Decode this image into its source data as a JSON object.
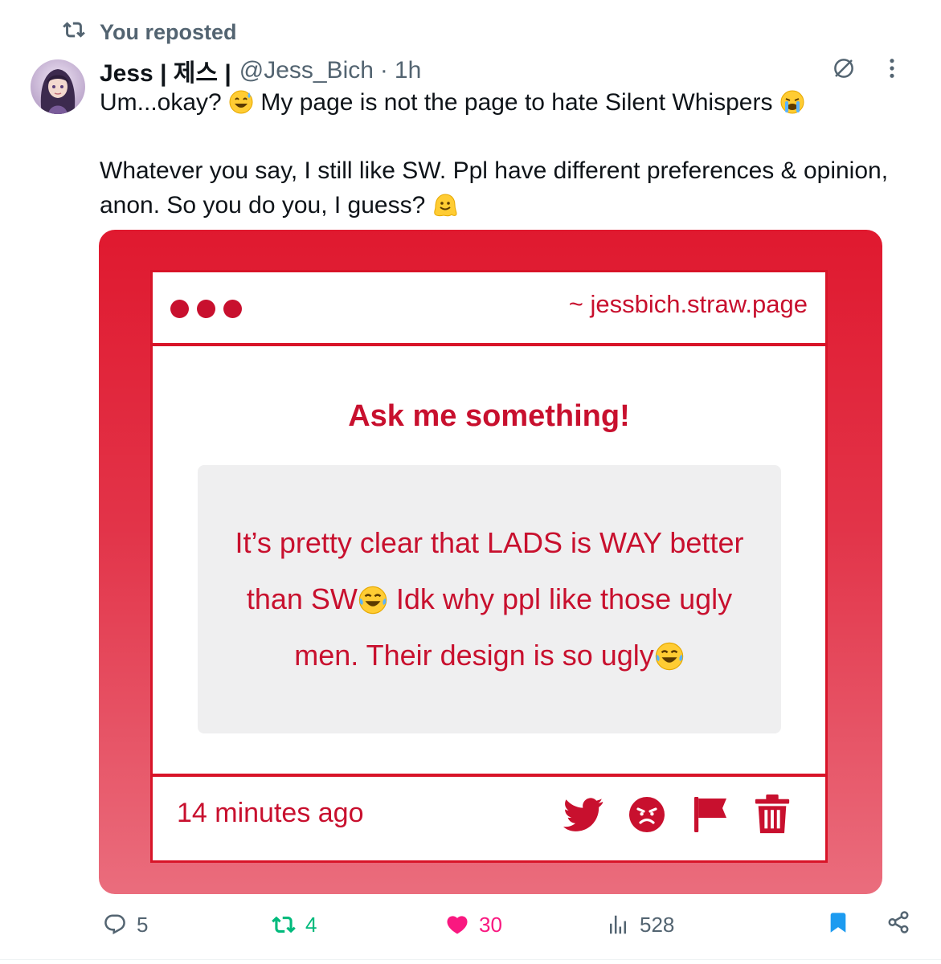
{
  "repost_banner": {
    "text": "You reposted"
  },
  "author": {
    "name": "Jess | 제스 |",
    "handle": "@Jess_Bich",
    "separator": "·",
    "time": "1h"
  },
  "tweet": {
    "line1": "Um...okay?",
    "line1b": " My page is not the page to hate Silent Whispers ",
    "line2": "Whatever you say, I still like SW. Ppl have different preferences & opinion, anon. So you do you, I guess? "
  },
  "media_card": {
    "url": "~ jessbich.straw.page",
    "title": "Ask me something!",
    "question_part1": "It’s pretty clear that LADS is WAY better than SW",
    "question_part2": " Idk why ppl like those ugly men. Their design is so ugly",
    "timestamp": "14 minutes ago",
    "accent_color": "#c8102e"
  },
  "engagement": {
    "replies": "5",
    "reposts": "4",
    "likes": "30",
    "views": "528"
  },
  "icons": [
    "repost-icon",
    "no-entry-icon",
    "more-icon",
    "reply-icon",
    "heart-icon",
    "views-icon",
    "bookmark-icon",
    "share-icon",
    "twitter-bird-icon",
    "angry-face-icon",
    "flag-icon",
    "trash-icon"
  ]
}
